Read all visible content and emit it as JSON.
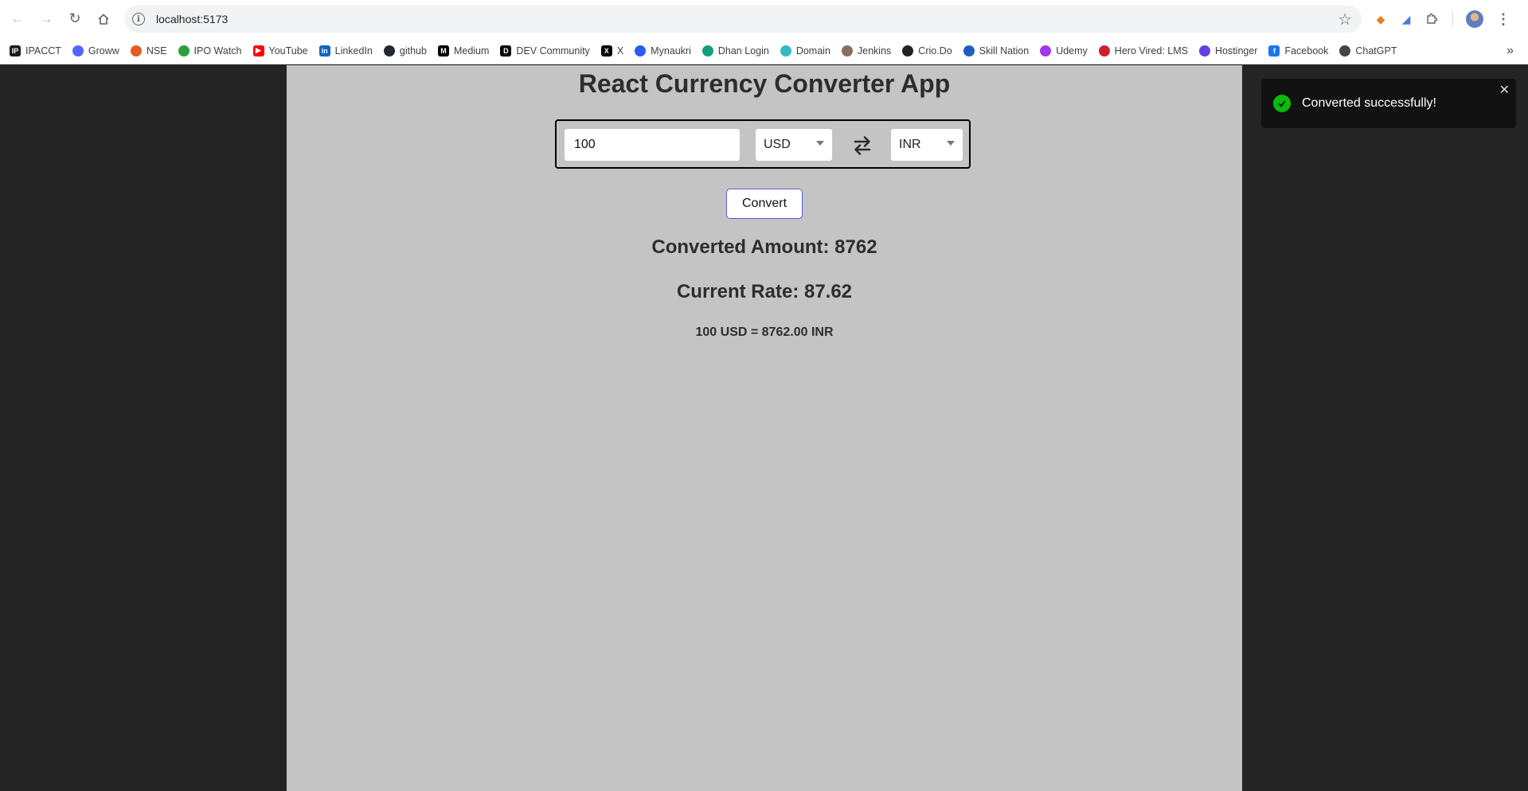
{
  "browser": {
    "url": "localhost:5173",
    "bookmarks": [
      {
        "label": "IPACCT",
        "icon": "ipacct-icon",
        "color": "#1a1a1a",
        "glyph": "IP"
      },
      {
        "label": "Groww",
        "icon": "groww-icon",
        "color": "#5367ff",
        "glyph": ""
      },
      {
        "label": "NSE",
        "icon": "nse-icon",
        "color": "#e55b21",
        "glyph": ""
      },
      {
        "label": "IPO Watch",
        "icon": "ipo-watch-icon",
        "color": "#2e9e3e",
        "glyph": ""
      },
      {
        "label": "YouTube",
        "icon": "youtube-icon",
        "color": "#ff0000",
        "glyph": "▶"
      },
      {
        "label": "LinkedIn",
        "icon": "linkedin-icon",
        "color": "#0a66c2",
        "glyph": "in"
      },
      {
        "label": "github",
        "icon": "github-icon",
        "color": "#24292f",
        "glyph": ""
      },
      {
        "label": "Medium",
        "icon": "medium-icon",
        "color": "#000000",
        "glyph": "M"
      },
      {
        "label": "DEV Community",
        "icon": "dev-community-icon",
        "color": "#000000",
        "glyph": "D"
      },
      {
        "label": "X",
        "icon": "x-icon",
        "color": "#000000",
        "glyph": "X"
      },
      {
        "label": "Mynaukri",
        "icon": "mynaukri-icon",
        "color": "#275df5",
        "glyph": ""
      },
      {
        "label": "Dhan Login",
        "icon": "dhan-icon",
        "color": "#13a07a",
        "glyph": ""
      },
      {
        "label": "Domain",
        "icon": "domain-icon",
        "color": "#34b8c9",
        "glyph": ""
      },
      {
        "label": "Jenkins",
        "icon": "jenkins-icon",
        "color": "#8a6d5a",
        "glyph": ""
      },
      {
        "label": "Crio.Do",
        "icon": "crio-icon",
        "color": "#222222",
        "glyph": ""
      },
      {
        "label": "Skill Nation",
        "icon": "skill-nation-icon",
        "color": "#1d5fbf",
        "glyph": ""
      },
      {
        "label": "Udemy",
        "icon": "udemy-icon",
        "color": "#a435f0",
        "glyph": ""
      },
      {
        "label": "Hero Vired: LMS",
        "icon": "hero-vired-icon",
        "color": "#d11f2e",
        "glyph": ""
      },
      {
        "label": "Hostinger",
        "icon": "hostinger-icon",
        "color": "#673de6",
        "glyph": ""
      },
      {
        "label": "Facebook",
        "icon": "facebook-icon",
        "color": "#1877f2",
        "glyph": "f"
      },
      {
        "label": "ChatGPT",
        "icon": "chatgpt-icon",
        "color": "#444444",
        "glyph": ""
      }
    ]
  },
  "app": {
    "title": "React Currency Converter App",
    "amount_value": "100",
    "from_currency": "USD",
    "to_currency": "INR",
    "convert_label": "Convert",
    "converted_amount": "Converted Amount: 8762",
    "current_rate": "Current Rate: 87.62",
    "summary": "100 USD = 8762.00 INR"
  },
  "toast": {
    "message": "Converted successfully!",
    "status_color": "#07bc0c"
  }
}
